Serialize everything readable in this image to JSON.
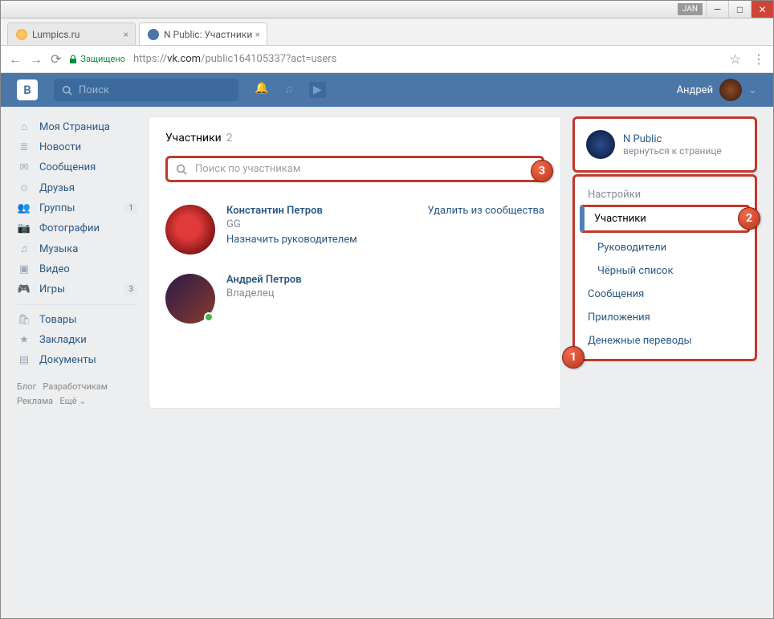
{
  "window": {
    "jan": "JAN"
  },
  "tabs": [
    {
      "title": "Lumpics.ru"
    },
    {
      "title": "N Public: Участники"
    }
  ],
  "addressbar": {
    "secure": "Защищено",
    "scheme": "https://",
    "host": "vk.com",
    "path": "/public164105337?act=users"
  },
  "header": {
    "search_placeholder": "Поиск",
    "username": "Андрей"
  },
  "leftnav": {
    "items": [
      {
        "label": "Моя Страница",
        "icon": "⌂"
      },
      {
        "label": "Новости",
        "icon": "≣"
      },
      {
        "label": "Сообщения",
        "icon": "✉"
      },
      {
        "label": "Друзья",
        "icon": "☺"
      },
      {
        "label": "Группы",
        "icon": "👥",
        "badge": "1"
      },
      {
        "label": "Фотографии",
        "icon": "📷"
      },
      {
        "label": "Музыка",
        "icon": "♫"
      },
      {
        "label": "Видео",
        "icon": "▣"
      },
      {
        "label": "Игры",
        "icon": "🎮",
        "badge": "3"
      }
    ],
    "items2": [
      {
        "label": "Товары",
        "icon": "🛍"
      },
      {
        "label": "Закладки",
        "icon": "★"
      },
      {
        "label": "Документы",
        "icon": "▤"
      }
    ],
    "footer": {
      "blog": "Блог",
      "dev": "Разработчикам",
      "ads": "Реклама",
      "more": "Ещё ⌄"
    }
  },
  "page": {
    "title": "Участники",
    "count": "2",
    "search_placeholder": "Поиск по участникам",
    "members": [
      {
        "name": "Константин Петров",
        "sub": "GG",
        "action": "Назначить руководителем",
        "remove": "Удалить из сообщества"
      },
      {
        "name": "Андрей Петров",
        "sub": "Владелец"
      }
    ]
  },
  "right": {
    "group_name": "N Public",
    "group_back": "вернуться к странице",
    "menu": {
      "settings": "Настройки",
      "members": "Участники",
      "managers": "Руководители",
      "blacklist": "Чёрный список",
      "messages": "Сообщения",
      "apps": "Приложения",
      "transfers": "Денежные переводы"
    }
  },
  "callouts": {
    "one": "1",
    "two": "2",
    "three": "3"
  }
}
